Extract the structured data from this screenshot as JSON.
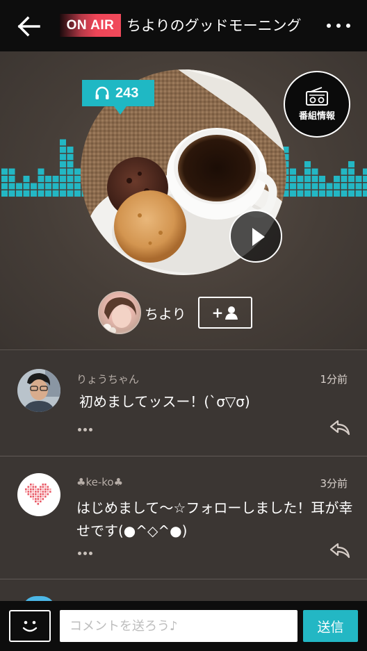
{
  "header": {
    "back_icon": "back-arrow-icon",
    "on_air_label": "ON AIR",
    "title": "ちよりのグッドモーニング",
    "more_icon": "more-dots-icon"
  },
  "hero": {
    "listener_count": "243",
    "listener_icon": "headphones-icon",
    "program_info_label": "番組情報",
    "program_info_icon": "radio-icon",
    "play_icon": "play-icon",
    "host_name": "ちより",
    "follow_icon": "add-user-icon",
    "follow_symbol": "+"
  },
  "comments": [
    {
      "username": "りょうちゃん",
      "time": "1分前",
      "text": "初めましてッスー！(`σ▽σ)",
      "more_icon": "ellipsis-icon",
      "reply_icon": "reply-icon"
    },
    {
      "username": "♣ke-ko♣",
      "time": "3分前",
      "text": "はじめまして〜☆フォローしました！耳が幸せです(●^◇^●)",
      "more_icon": "ellipsis-icon",
      "reply_icon": "reply-icon"
    }
  ],
  "footer": {
    "emoji_icon": "smiley-icon",
    "comment_placeholder": "コメントを送ろう♪",
    "send_label": "送信"
  },
  "colors": {
    "accent": "#23b7c4",
    "on_air": "#ef4557",
    "bar": "#0d0d0d",
    "background": "#3b3633"
  }
}
